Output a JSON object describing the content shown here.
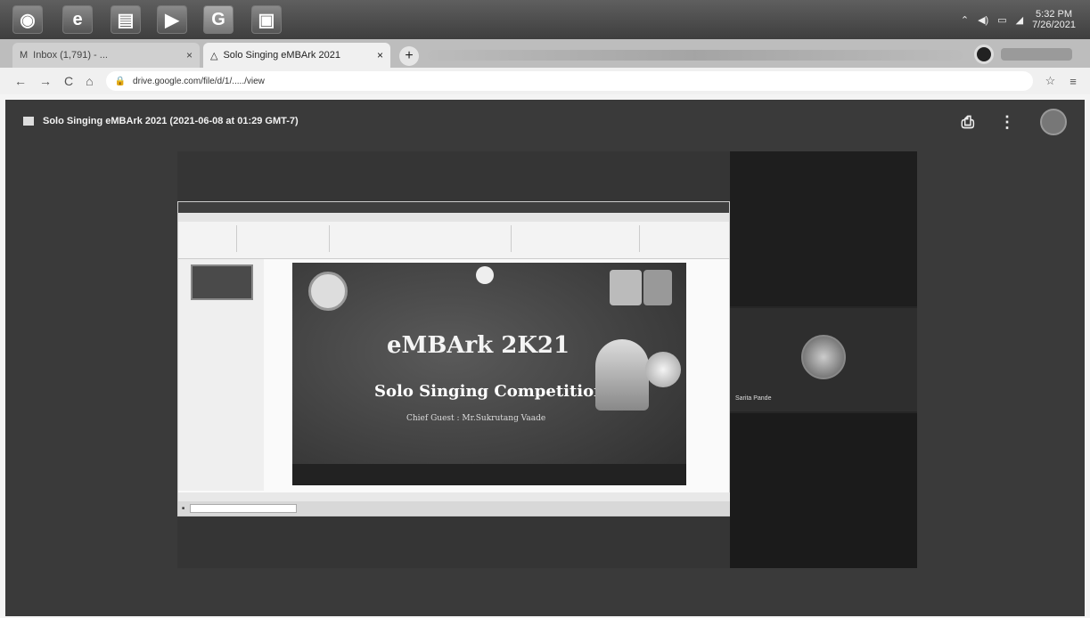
{
  "taskbar": {
    "icons": [
      "browser-icon",
      "ie-icon",
      "app-icon",
      "media-icon",
      "chrome-icon",
      "window-icon"
    ],
    "clock_time": "5:32 PM",
    "clock_date": "7/26/2021"
  },
  "browser": {
    "tabs": [
      {
        "label": "Inbox (1,791) - ...",
        "active": false
      },
      {
        "label": "Solo Singing eMBArk 2021",
        "active": true
      }
    ],
    "url": "drive.google.com/file/d/1/...../view"
  },
  "viewer": {
    "file_title": "Solo Singing eMBArk 2021 (2021-06-08 at 01:29 GMT-7)",
    "participant_name": "Sarita Pande"
  },
  "slide": {
    "event": "eMBArk 2K21",
    "competition": "Solo Singing Competition",
    "guest": "Chief Guest : Mr.Sukrutang Vaade"
  }
}
